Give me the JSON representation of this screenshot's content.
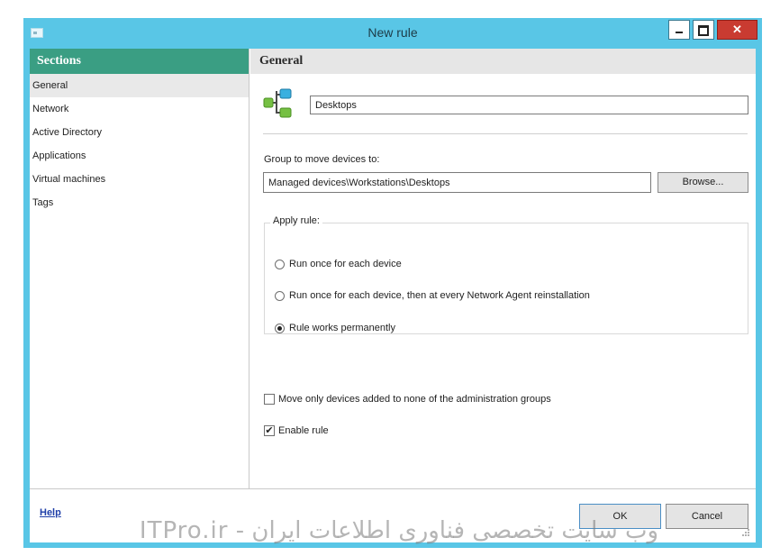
{
  "window": {
    "title": "New rule",
    "controls": {
      "minimize": "minimize-icon",
      "maximize": "maximize-icon",
      "close": "close-icon"
    }
  },
  "sidebar": {
    "header": "Sections",
    "items": [
      {
        "label": "General",
        "selected": true
      },
      {
        "label": "Network",
        "selected": false
      },
      {
        "label": "Active Directory",
        "selected": false
      },
      {
        "label": "Applications",
        "selected": false
      },
      {
        "label": "Virtual machines",
        "selected": false
      },
      {
        "label": "Tags",
        "selected": false
      }
    ]
  },
  "main": {
    "header": "General",
    "rule_name": "Desktops",
    "group_label": "Group to move devices to:",
    "group_path": "Managed devices\\Workstations\\Desktops",
    "browse_label": "Browse...",
    "apply_rule": {
      "legend": "Apply rule:",
      "options": [
        {
          "label": "Run once for each device",
          "checked": false
        },
        {
          "label": "Run once for each device, then at every Network Agent reinstallation",
          "checked": false
        },
        {
          "label": "Rule works permanently",
          "checked": true
        }
      ]
    },
    "move_only_label": "Move only devices added to none of the administration groups",
    "move_only_checked": false,
    "enable_rule_label": "Enable rule",
    "enable_rule_checked": true
  },
  "footer": {
    "help_label": "Help",
    "ok_label": "OK",
    "cancel_label": "Cancel"
  },
  "watermark": "وب سایت تخصصی فناوری اطلاعات ایران - ITPro.ir",
  "colors": {
    "titlebar": "#59c6e6",
    "sidebar_header": "#3a9e83",
    "close_button": "#c93b31",
    "link": "#1f3fa8"
  }
}
